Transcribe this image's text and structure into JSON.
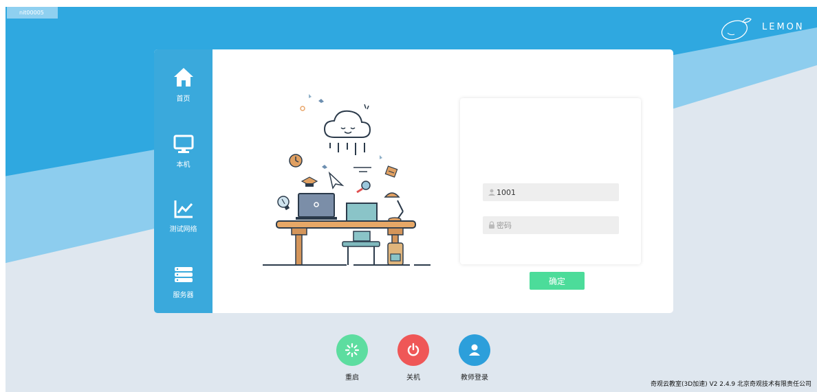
{
  "window": {
    "machine_id": "nit00005"
  },
  "brand": {
    "name": "LEMON"
  },
  "sidebar": {
    "items": [
      {
        "label": "首页",
        "icon": "home-icon"
      },
      {
        "label": "本机",
        "icon": "monitor-icon"
      },
      {
        "label": "测试网络",
        "icon": "chart-line-icon"
      },
      {
        "label": "服务器",
        "icon": "server-icon"
      }
    ]
  },
  "login": {
    "username_value": "1001",
    "password_placeholder": "密码",
    "confirm_label": "确定"
  },
  "bottom": {
    "restart_label": "重启",
    "shutdown_label": "关机",
    "teacher_login_label": "教师登录"
  },
  "footer": {
    "text": "奇观云教室(3D加速) V2  2.4.9 北京奇观技术有限责任公司"
  },
  "colors": {
    "primary_blue": "#2fa8e0",
    "sidebar_blue": "#3aa9dc",
    "restart_green": "#5ddda0",
    "shutdown_red": "#ef5757",
    "teacher_blue": "#2c9fdb",
    "confirm_green": "#4cdc9a"
  }
}
